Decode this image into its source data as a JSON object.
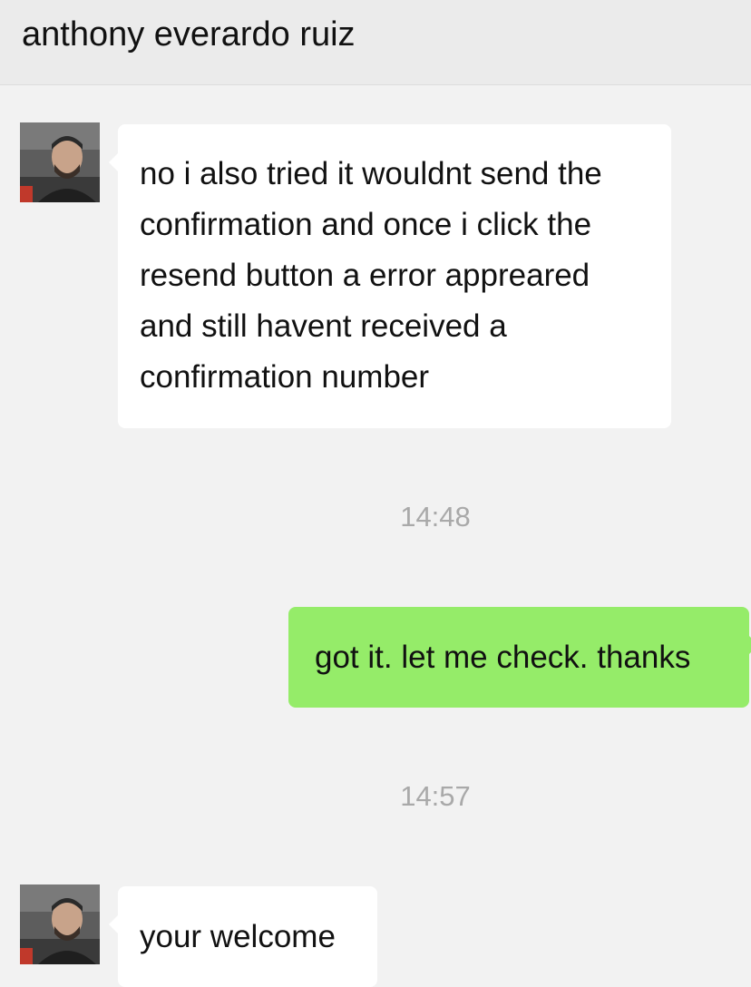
{
  "header": {
    "title": "anthony everardo ruiz"
  },
  "messages": [
    {
      "direction": "incoming",
      "avatar_icon": "contact-avatar-icon",
      "text": "no i also tried it wouldnt send the\nconfirmation and once i click the\nresend button a error appreared\nand still havent received a\nconfirmation number"
    },
    {
      "direction": "outgoing",
      "text": "got it. let me check. thanks"
    },
    {
      "direction": "incoming",
      "avatar_icon": "contact-avatar-icon",
      "text": "your welcome"
    }
  ],
  "timestamps": [
    "14:48",
    "14:57"
  ],
  "colors": {
    "background": "#f2f2f2",
    "header_background": "#ebebeb",
    "incoming_bubble": "#ffffff",
    "outgoing_bubble": "#95ec69",
    "timestamp_text": "#a9a9a9"
  }
}
